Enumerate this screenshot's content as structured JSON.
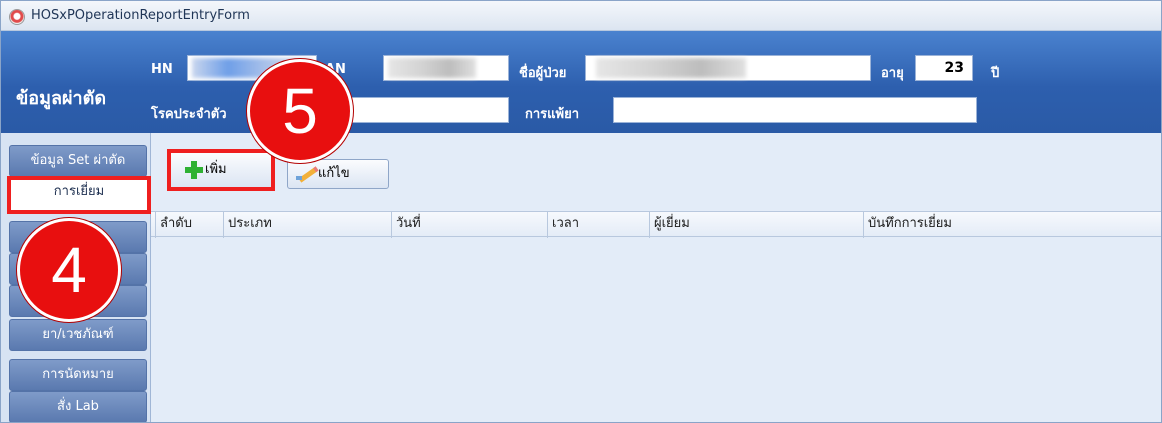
{
  "window": {
    "title": "HOSxPOperationReportEntryForm"
  },
  "header": {
    "title": "ข้อมูลผ่าตัด",
    "hn_label": "HN",
    "an_label": "AN",
    "name_label": "ชื่อผู้ป่วย",
    "age_label": "อายุ",
    "age_value": "23",
    "age_unit": "ปี",
    "disease_label": "โรคประจำตัว",
    "allergy_label": "การแพ้ยา"
  },
  "sidebar": {
    "items": [
      {
        "label": "ข้อมูล Set ผ่าตัด"
      },
      {
        "label": "การเยี่ยม"
      },
      {
        "label": ""
      },
      {
        "label": ""
      },
      {
        "label": ""
      },
      {
        "label": "ยา/เวชภัณฑ์"
      },
      {
        "label": "การนัดหมาย"
      },
      {
        "label": "สั่ง Lab"
      }
    ]
  },
  "toolbar": {
    "add_label": "เพิ่ม",
    "edit_label": "แก้ไข"
  },
  "table": {
    "columns": [
      "ลำดับ",
      "ประเภท",
      "วันที่",
      "เวลา",
      "ผู้เยี่ยม",
      "บันทึกการเยี่ยม"
    ]
  },
  "annotations": {
    "callout_4": "4",
    "callout_5": "5"
  },
  "colors": {
    "header_blue": "#2d5fae",
    "highlight_red": "#ef1f1f"
  }
}
